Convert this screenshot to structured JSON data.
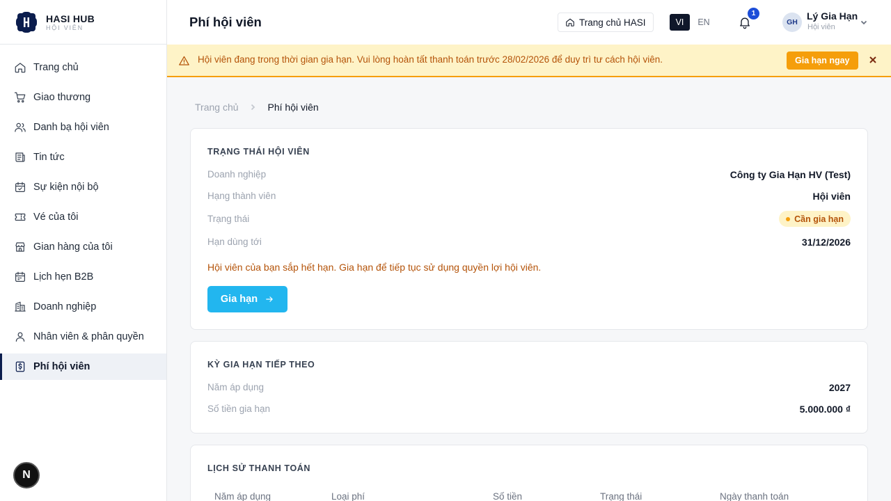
{
  "brand": {
    "title": "HASI HUB",
    "subtitle": "HỘI VIÊN"
  },
  "sidebar": {
    "items": [
      {
        "label": "Trang chủ",
        "icon": "home-icon"
      },
      {
        "label": "Giao thương",
        "icon": "cart-icon"
      },
      {
        "label": "Danh bạ hội viên",
        "icon": "users-icon"
      },
      {
        "label": "Tin tức",
        "icon": "newspaper-icon"
      },
      {
        "label": "Sự kiện nội bộ",
        "icon": "calendar-check-icon"
      },
      {
        "label": "Vé của tôi",
        "icon": "ticket-icon"
      },
      {
        "label": "Gian hàng của tôi",
        "icon": "store-icon"
      },
      {
        "label": "Lịch hẹn B2B",
        "icon": "calendar-icon"
      },
      {
        "label": "Doanh nghiệp",
        "icon": "building-icon"
      },
      {
        "label": "Nhân viên & phân quyền",
        "icon": "user-icon"
      },
      {
        "label": "Phí hội viên",
        "icon": "dollar-receipt-icon",
        "active": true
      }
    ],
    "bottom_badge": "N"
  },
  "header": {
    "title": "Phí hội viên",
    "home_button": "Trang chủ HASI",
    "lang_active": "VI",
    "lang_other": "EN",
    "notification_count": "1",
    "user": {
      "initials": "GH",
      "name": "Lý Gia Hạn",
      "role": "Hội viên"
    }
  },
  "banner": {
    "message": "Hội viên đang trong thời gian gia hạn. Vui lòng hoàn tất thanh toán trước 28/02/2026 để duy trì tư cách hội viên.",
    "action": "Gia hạn ngay",
    "color": "#fef3c7",
    "accent": "#f59e0b"
  },
  "breadcrumb": {
    "home": "Trang chủ",
    "current": "Phí hội viên"
  },
  "membership_status": {
    "title": "TRẠNG THÁI HỘI VIÊN",
    "rows": [
      {
        "label": "Doanh nghiệp",
        "value": "Công ty Gia Hạn HV (Test)"
      },
      {
        "label": "Hạng thành viên",
        "value": "Hội viên"
      },
      {
        "label": "Trạng thái",
        "value": "Cần gia hạn"
      },
      {
        "label": "Hạn dùng tới",
        "value": "31/12/2026"
      }
    ],
    "warning": "Hội viên của bạn sắp hết hạn. Gia hạn để tiếp tục sử dụng quyền lợi hội viên.",
    "button": "Gia hạn",
    "button_color": "#22b6ef"
  },
  "next_period": {
    "title": "KỲ GIA HẠN TIẾP THEO",
    "rows": [
      {
        "label": "Năm áp dụng",
        "value": "2027"
      },
      {
        "label": "Số tiền gia hạn",
        "value": "5.000.000 ₫"
      }
    ]
  },
  "payment_history": {
    "title": "LỊCH SỬ THANH TOÁN",
    "columns": [
      "Năm áp dụng",
      "Loại phí",
      "Số tiền",
      "Trạng thái",
      "Ngày thanh toán"
    ]
  }
}
